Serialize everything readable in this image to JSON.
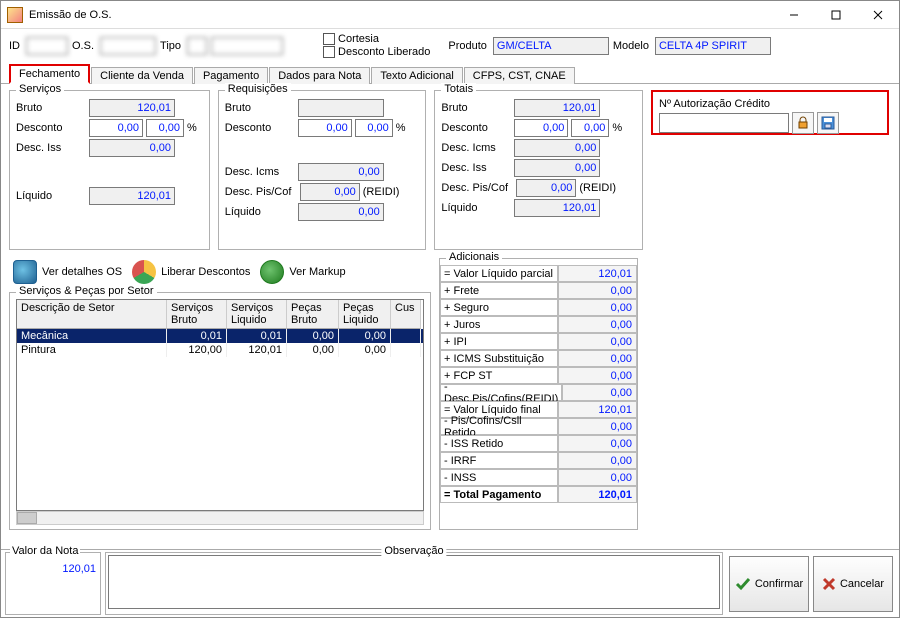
{
  "window": {
    "title": "Emissão de O.S."
  },
  "top": {
    "id_label": "ID",
    "id_value": "",
    "os_label": "O.S.",
    "os_value": "",
    "tipo_label": "Tipo",
    "tipo_value1": "",
    "tipo_value2": "",
    "cortesia": "Cortesia",
    "desc_lib": "Desconto Liberado",
    "produto_label": "Produto",
    "produto_value": "GM/CELTA",
    "modelo_label": "Modelo",
    "modelo_value": "CELTA 4P SPIRIT"
  },
  "tabs": [
    "Fechamento",
    "Cliente da Venda",
    "Pagamento",
    "Dados para Nota",
    "Texto Adicional",
    "CFPS, CST, CNAE"
  ],
  "servicos": {
    "legend": "Serviços",
    "bruto_l": "Bruto",
    "bruto": "120,01",
    "desc_l": "Desconto",
    "desc": "0,00",
    "desc_pct": "0,00",
    "desciss_l": "Desc. Iss",
    "desciss": "0,00",
    "liq_l": "Líquido",
    "liq": "120,01"
  },
  "requisicoes": {
    "legend": "Requisições",
    "bruto_l": "Bruto",
    "bruto": "",
    "desc_l": "Desconto",
    "desc": "0,00",
    "desc_pct": "0,00",
    "descicms_l": "Desc. Icms",
    "descicms": "0,00",
    "descpc_l": "Desc. Pis/Cof",
    "descpc": "0,00",
    "descpc_suf": "(REIDI)",
    "liq_l": "Líquido",
    "liq": "0,00"
  },
  "totais": {
    "legend": "Totais",
    "bruto_l": "Bruto",
    "bruto": "120,01",
    "desc_l": "Desconto",
    "desc": "0,00",
    "desc_pct": "0,00",
    "descicms_l": "Desc. Icms",
    "descicms": "0,00",
    "desciss_l": "Desc. Iss",
    "desciss": "0,00",
    "descpc_l": "Desc. Pis/Cof",
    "descpc": "0,00",
    "descpc_suf": "(REIDI)",
    "liq_l": "Líquido",
    "liq": "120,01"
  },
  "auth": {
    "label": "Nº Autorização Crédito",
    "value": ""
  },
  "actions": {
    "detail": "Ver detalhes OS",
    "liberar": "Liberar Descontos",
    "markup": "Ver Markup"
  },
  "setor": {
    "legend": "Serviços & Peças por Setor",
    "cols": [
      "Descrição de Setor",
      "Serviços Bruto",
      "Serviços Liquido",
      "Peças Bruto",
      "Peças Liquido",
      "Cus"
    ],
    "rows": [
      {
        "desc": "Mecânica",
        "sb": "0,01",
        "sl": "0,01",
        "pb": "0,00",
        "pl": "0,00",
        "c": ""
      },
      {
        "desc": "Pintura",
        "sb": "120,00",
        "sl": "120,01",
        "pb": "0,00",
        "pl": "0,00",
        "c": ""
      }
    ]
  },
  "adicionais": {
    "legend": "Adicionais",
    "rows": [
      {
        "l": "= Valor Líquido parcial",
        "v": "120,01"
      },
      {
        "l": "+ Frete",
        "v": "0,00"
      },
      {
        "l": "+ Seguro",
        "v": "0,00"
      },
      {
        "l": "+ Juros",
        "v": "0,00"
      },
      {
        "l": "+ IPI",
        "v": "0,00"
      },
      {
        "l": "+ ICMS Substituição",
        "v": "0,00"
      },
      {
        "l": "+ FCP ST",
        "v": "0,00"
      },
      {
        "l": "- Desc.Pis/Cofins(REIDI)",
        "v": "0,00"
      },
      {
        "l": "= Valor Líquido final",
        "v": "120,01"
      },
      {
        "l": "- Pis/Cofins/Csll Retido",
        "v": "0,00"
      },
      {
        "l": "- ISS Retido",
        "v": "0,00"
      },
      {
        "l": "- IRRF",
        "v": "0,00"
      },
      {
        "l": "- INSS",
        "v": "0,00"
      },
      {
        "l": "= Total Pagamento",
        "v": "120,01",
        "total": true
      }
    ]
  },
  "bottom": {
    "valor_nota_l": "Valor da Nota",
    "valor_nota": "120,01",
    "obs_l": "Observação",
    "confirmar": "Confirmar",
    "cancelar": "Cancelar"
  }
}
